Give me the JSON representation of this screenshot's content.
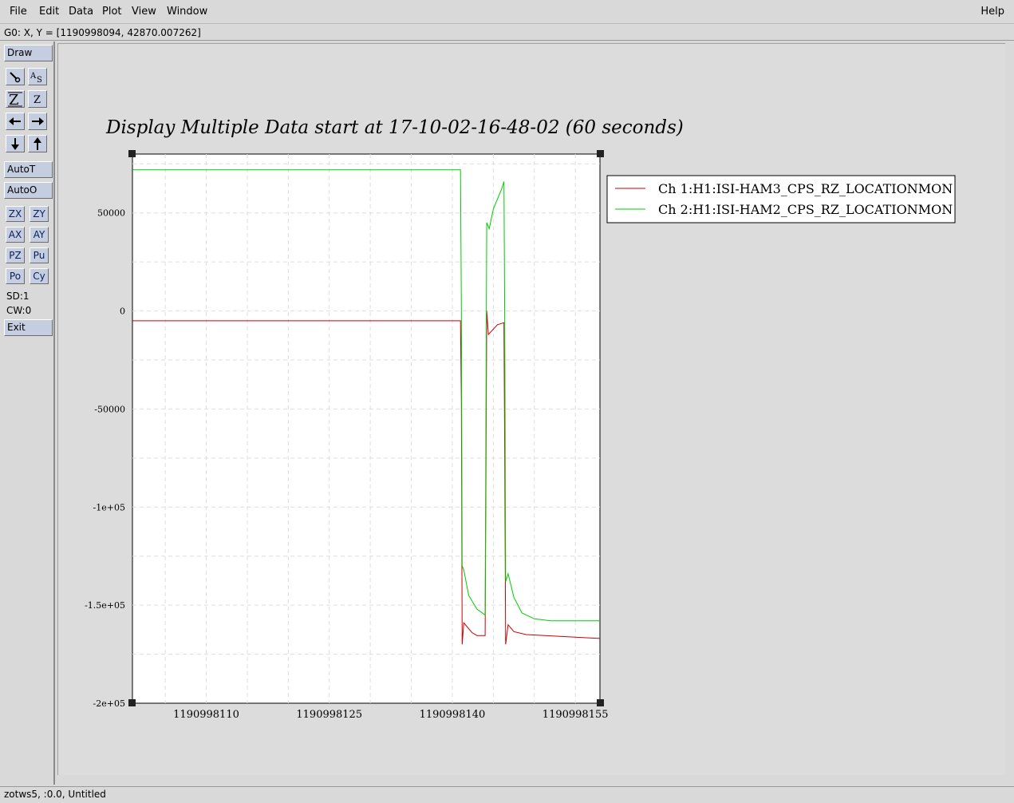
{
  "menubar": {
    "items": [
      "File",
      "Edit",
      "Data",
      "Plot",
      "View",
      "Window"
    ],
    "help": "Help"
  },
  "coord_readout": "G0: X, Y = [1190998094, 42870.007262]",
  "toolbar": {
    "draw": "Draw",
    "icons": [
      "zoom-tool-icon",
      "text-tool-icon",
      "zoom-in-icon",
      "zoom-out-icon",
      "pan-left-icon",
      "pan-right-icon",
      "pan-down-icon",
      "pan-up-icon"
    ],
    "auto_t": "AutoT",
    "auto_o": "AutoO",
    "grid_buttons": [
      "ZX",
      "ZY",
      "AX",
      "AY",
      "PZ",
      "Pu",
      "Po",
      "Cy"
    ],
    "sd": "SD:1",
    "cw": "CW:0",
    "exit": "Exit"
  },
  "chart_data": {
    "type": "line",
    "title": "Display Multiple Data start at 17-10-02-16-48-02 (60 seconds)",
    "xlim": [
      1190998101,
      1190998158
    ],
    "ylim": [
      -200000,
      80000
    ],
    "x_ticks": [
      "1190998110",
      "1190998125",
      "1190998140",
      "1190998155"
    ],
    "x_tick_values": [
      1190998110,
      1190998125,
      1190998140,
      1190998155
    ],
    "y_ticks": [
      "50000",
      "0",
      "-50000",
      "-1e+05",
      "-1.5e+05",
      "-2e+05"
    ],
    "y_tick_values": [
      50000,
      0,
      -50000,
      -100000,
      -150000,
      -200000
    ],
    "grid": true,
    "legend": "right",
    "series": [
      {
        "name": "Ch 1:H1:ISI-HAM3_CPS_RZ_LOCATIONMON",
        "color": "#cc0000",
        "points": [
          [
            1190998101,
            -5000
          ],
          [
            1190998141,
            -5000
          ],
          [
            1190998141.1,
            -45000
          ],
          [
            1190998141.2,
            -170000
          ],
          [
            1190998141.4,
            -159000
          ],
          [
            1190998142.4,
            -164000
          ],
          [
            1190998143,
            -165500
          ],
          [
            1190998144,
            -165500
          ],
          [
            1190998144.1,
            -85000
          ],
          [
            1190998144.2,
            0
          ],
          [
            1190998144.4,
            -12000
          ],
          [
            1190998145.5,
            -7000
          ],
          [
            1190998146.3,
            -6000
          ],
          [
            1190998146.4,
            -78000
          ],
          [
            1190998146.5,
            -170000
          ],
          [
            1190998146.8,
            -160000
          ],
          [
            1190998147.5,
            -163500
          ],
          [
            1190998149,
            -165000
          ],
          [
            1190998158,
            -167000
          ]
        ]
      },
      {
        "name": "Ch 2:H1:ISI-HAM2_CPS_RZ_LOCATIONMON",
        "color": "#00cc00",
        "points": [
          [
            1190998101,
            72000
          ],
          [
            1190998141,
            72000
          ],
          [
            1190998141.1,
            2000
          ],
          [
            1190998141.2,
            -130000
          ],
          [
            1190998141.4,
            -132000
          ],
          [
            1190998142,
            -145000
          ],
          [
            1190998143,
            -152000
          ],
          [
            1190998144,
            -155000
          ],
          [
            1190998144.2,
            45000
          ],
          [
            1190998144.5,
            42000
          ],
          [
            1190998145,
            52000
          ],
          [
            1190998145.5,
            57000
          ],
          [
            1190998146,
            62000
          ],
          [
            1190998146.3,
            66000
          ],
          [
            1190998146.4,
            -10000
          ],
          [
            1190998146.5,
            -138000
          ],
          [
            1190998146.8,
            -134000
          ],
          [
            1190998147.5,
            -146000
          ],
          [
            1190998148.5,
            -154000
          ],
          [
            1190998150,
            -157000
          ],
          [
            1190998152,
            -158000
          ],
          [
            1190998158,
            -158000
          ]
        ]
      }
    ]
  },
  "statusbar": "zotws5, :0.0, Untitled"
}
